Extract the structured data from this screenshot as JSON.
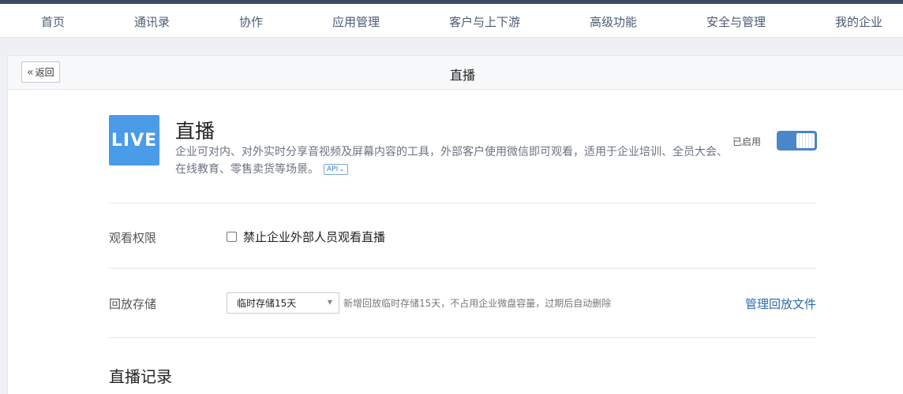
{
  "nav": {
    "items": [
      "首页",
      "通讯录",
      "协作",
      "应用管理",
      "客户与上下游",
      "高级功能",
      "安全与管理",
      "我的企业"
    ]
  },
  "header": {
    "back_label": "返回",
    "back_icon": "double-chevron-left-icon",
    "title": "直播"
  },
  "app": {
    "icon_text": "LIVE",
    "name": "直播",
    "description": "企业可对内、对外实时分享音视频及屏幕内容的工具，外部客户使用微信即可观看，适用于企业培训、全员大会、在线教育、零售卖货等场景。",
    "api_badge": "API",
    "status_label": "已启用",
    "enabled": true
  },
  "settings": {
    "view_permission": {
      "label": "观看权限",
      "checkbox_label": "禁止企业外部人员观看直播",
      "checked": false
    },
    "playback_storage": {
      "label": "回放存储",
      "selected": "临时存储15天",
      "hint": "新增回放临时存储15天，不占用企业微盘容量，过期后自动删除",
      "manage_link": "管理回放文件"
    }
  },
  "records": {
    "title": "直播记录"
  },
  "colors": {
    "accent": "#4a86c8",
    "app_icon_bg": "#4a9be8",
    "link": "#2a6ab0",
    "top_strip": "#3a4c63"
  }
}
